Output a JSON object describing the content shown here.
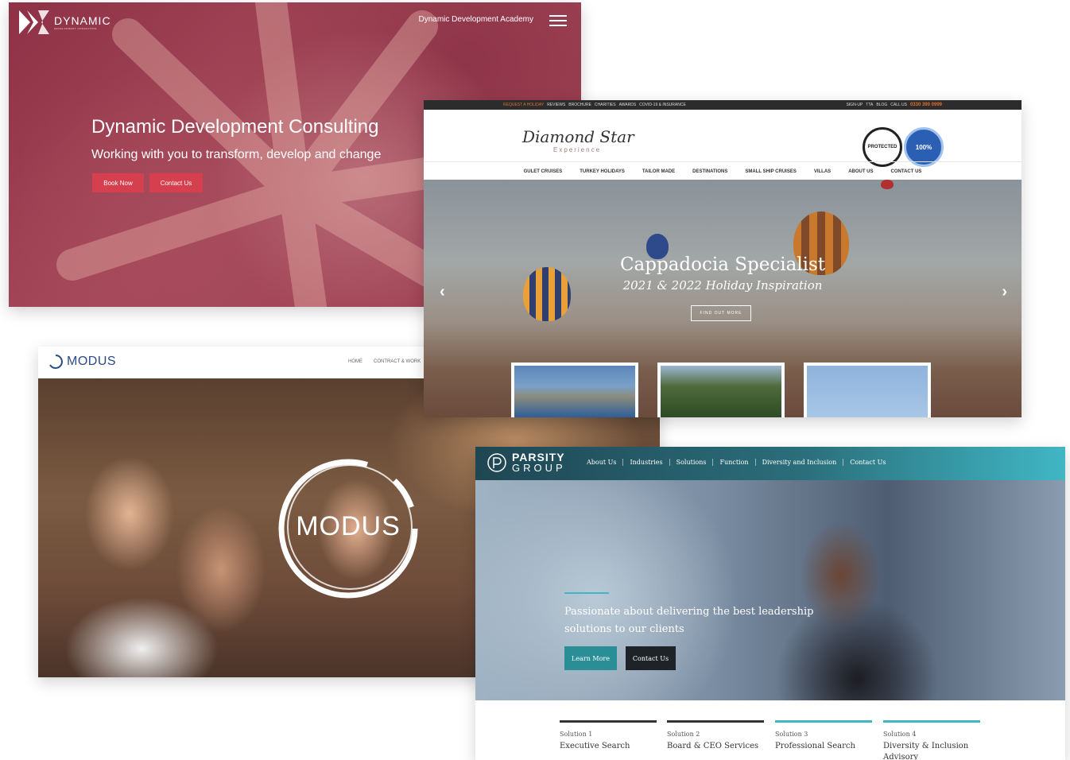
{
  "dynamic": {
    "brand": "DYNAMIC",
    "brand_sub": "DEVELOPMENT CONSULTING",
    "nav_link": "Dynamic Development Academy",
    "title": "Dynamic Development Consulting",
    "subtitle": "Working with you to transform, develop and change",
    "book_btn": "Book Now",
    "contact_btn": "Contact Us",
    "accent": "#d63f4d"
  },
  "modus": {
    "brand": "MODUS",
    "nav": [
      "HOME",
      "CONTRACT & WORK"
    ],
    "hero_text": "MODUS",
    "brand_color": "#2b4a86"
  },
  "diamond": {
    "topbar_left": [
      "REQUEST A HOLIDAY",
      "REVIEWS",
      "BROCHURE",
      "CHARITIES",
      "AWARDS",
      "COVID-19 & INSURANCE"
    ],
    "topbar_right": [
      "SIGN-UP",
      "TTA",
      "BLOG",
      "CALL US"
    ],
    "phone": "0330 390 0999",
    "logo": "Diamond Star",
    "logo_sub": "Experience",
    "badge_1": "PROTECTED",
    "badge_2": "100%",
    "nav": [
      "GULET CRUISES",
      "TURKEY HOLIDAYS",
      "TAILOR MADE",
      "DESTINATIONS",
      "SMALL SHIP CRUISES",
      "VILLAS",
      "ABOUT US",
      "CONTACT US"
    ],
    "hero_title": "Cappadocia Specialist",
    "hero_sub": "2021 & 2022 Holiday Inspiration",
    "cta": "FIND OUT MORE",
    "prev_arrow": "‹",
    "next_arrow": "›"
  },
  "parsity": {
    "brand_1": "PARSITY",
    "brand_2": "GROUP",
    "nav": [
      "About Us",
      "Industries",
      "Solutions",
      "Function",
      "Diversity and Inclusion",
      "Contact Us"
    ],
    "hero_text": "Passionate about delivering the best leadership solutions to our clients",
    "learn_btn": "Learn More",
    "contact_btn": "Contact Us",
    "solutions": [
      {
        "kicker": "Solution 1",
        "title": "Executive Search"
      },
      {
        "kicker": "Solution 2",
        "title": "Board & CEO Services"
      },
      {
        "kicker": "Solution 3",
        "title": "Professional Search"
      },
      {
        "kicker": "Solution 4",
        "title": "Diversity & Inclusion Advisory"
      }
    ],
    "accent": "#41b6c4"
  }
}
